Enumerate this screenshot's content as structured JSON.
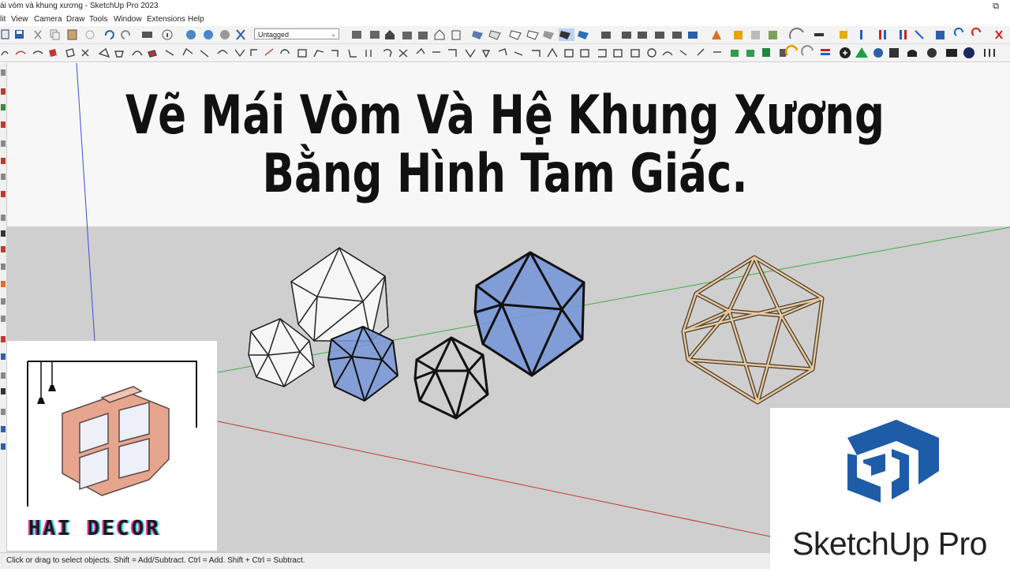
{
  "window": {
    "title": "ái vòm và khung xương - SketchUp Pro 2023",
    "restore_icon": "restore-window-icon"
  },
  "menu": [
    "lit",
    "View",
    "Camera",
    "Draw",
    "Tools",
    "Window",
    "Extensions",
    "Help"
  ],
  "toolbar": {
    "tag_select_value": "Untagged"
  },
  "headline": {
    "line1": "Vẽ Mái Vòm Và Hệ Khung Xương",
    "line2": "Bằng Hình Tam Giác."
  },
  "logo_left": {
    "text": "HAI DECOR"
  },
  "logo_right": {
    "text": "SketchUp Pro"
  },
  "status": {
    "text": "Click or drag to select objects. Shift = Add/Subtract. Ctrl = Add. Shift + Ctrl = Subtract."
  },
  "colors": {
    "axis_green": "#3fae3f",
    "axis_red": "#c0392b",
    "axis_blue": "#3a4ee0",
    "sketchup_blue": "#1f5ca8",
    "glass_blue": "#7797d8",
    "wood": "#e8c9a0",
    "logo_pink": "#e8a58d"
  }
}
